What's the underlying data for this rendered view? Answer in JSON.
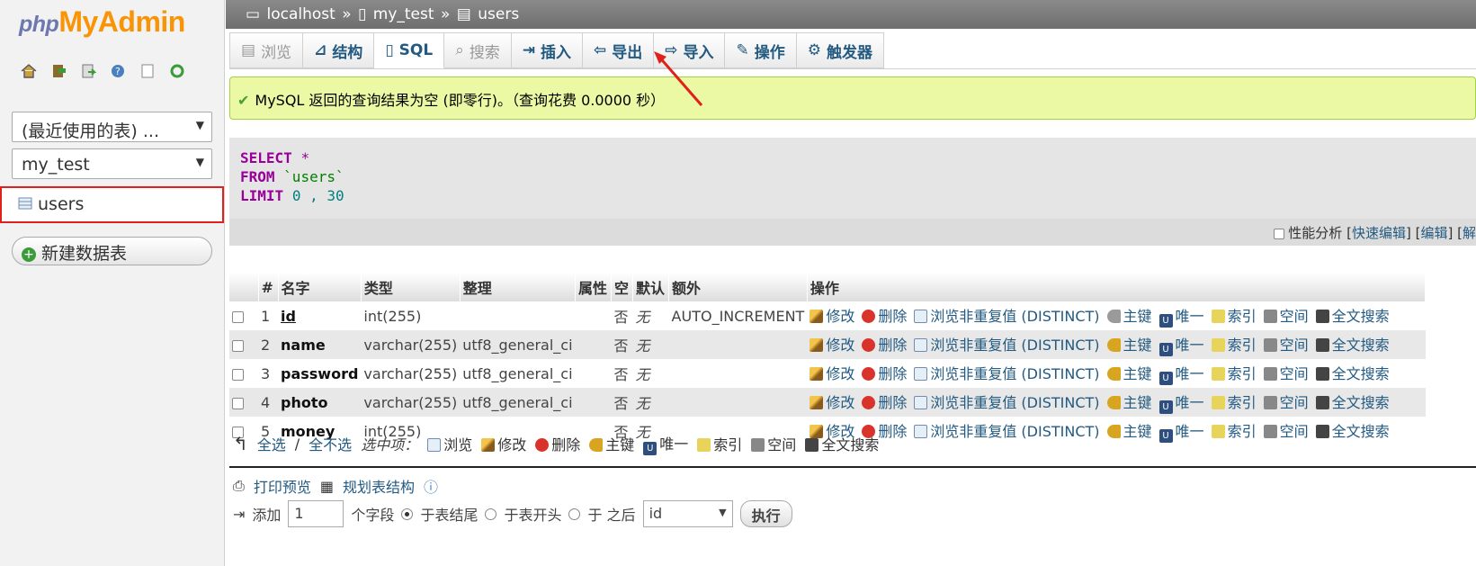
{
  "sidebar": {
    "logo_php": "php",
    "logo_myadmin": "MyAdmin",
    "icons": [
      "home-icon",
      "exit-icon",
      "sql-query-icon",
      "help-icon",
      "docs-icon",
      "reload-icon"
    ],
    "recent_tables": "(最近使用的表) ...",
    "database": "my_test",
    "table": "users",
    "new_table": "新建数据表"
  },
  "breadcrumb": {
    "server": "localhost",
    "sep1": "»",
    "database": "my_test",
    "sep2": "»",
    "table": "users"
  },
  "tabs": [
    {
      "label": "浏览",
      "state": "disabled"
    },
    {
      "label": "结构",
      "state": "normal"
    },
    {
      "label": "SQL",
      "state": "active"
    },
    {
      "label": "搜索",
      "state": "disabled"
    },
    {
      "label": "插入",
      "state": "normal"
    },
    {
      "label": "导出",
      "state": "normal"
    },
    {
      "label": "导入",
      "state": "normal"
    },
    {
      "label": "操作",
      "state": "normal"
    },
    {
      "label": "触发器",
      "state": "normal"
    }
  ],
  "message": "MySQL 返回的查询结果为空 (即零行)。（查询花费 0.0000 秒）",
  "sql": {
    "select": "SELECT",
    "star": "*",
    "from": "FROM",
    "table": "`users`",
    "limit": "LIMIT",
    "offset": "0",
    "comma": ",",
    "count": "30"
  },
  "sqlbar": {
    "profiling": "性能分析",
    "lb1": "[",
    "inline_edit": "快速编辑",
    "rb1": "]",
    "lb2": "[",
    "edit": "编辑",
    "rb2": "]",
    "lb3": "[",
    "explain": "解"
  },
  "columns_header": [
    "",
    "#",
    "名字",
    "类型",
    "整理",
    "属性",
    "空",
    "默认",
    "额外",
    "操作"
  ],
  "columns": [
    {
      "n": "1",
      "name": "id",
      "type": "int(255)",
      "collation": "",
      "attr": "",
      "null": "否",
      "default": "无",
      "extra": "AUTO_INCREMENT"
    },
    {
      "n": "2",
      "name": "name",
      "type": "varchar(255)",
      "collation": "utf8_general_ci",
      "attr": "",
      "null": "否",
      "default": "无",
      "extra": ""
    },
    {
      "n": "3",
      "name": "password",
      "type": "varchar(255)",
      "collation": "utf8_general_ci",
      "attr": "",
      "null": "否",
      "default": "无",
      "extra": ""
    },
    {
      "n": "4",
      "name": "photo",
      "type": "varchar(255)",
      "collation": "utf8_general_ci",
      "attr": "",
      "null": "否",
      "default": "无",
      "extra": ""
    },
    {
      "n": "5",
      "name": "money",
      "type": "int(255)",
      "collation": "",
      "attr": "",
      "null": "否",
      "default": "无",
      "extra": ""
    }
  ],
  "actions": {
    "edit": "修改",
    "drop": "删除",
    "distinct": "浏览非重复值 (DISTINCT)",
    "primary": "主键",
    "unique": "唯一",
    "index": "索引",
    "spatial": "空间",
    "fulltext": "全文搜索"
  },
  "multi": {
    "check_all": "全选",
    "sep": "/",
    "uncheck_all": "全不选",
    "with_selected": "选中项：",
    "browse": "浏览",
    "edit": "修改",
    "drop": "删除",
    "primary": "主键",
    "unique": "唯一",
    "index": "索引",
    "spatial": "空间",
    "fulltext": "全文搜索"
  },
  "links": {
    "print": "打印预览",
    "relation": "规划表结构"
  },
  "addrow": {
    "add": "添加",
    "count": "1",
    "fields": "个字段",
    "at_end": "于表结尾",
    "at_beginning": "于表开头",
    "after_label": "于 之后",
    "after_field": "id",
    "go": "执行"
  },
  "colors": {
    "link": "#235a81",
    "success_bg": "#ebf8a4",
    "keyword": "#990099",
    "highlight_red": "#e0201a"
  }
}
